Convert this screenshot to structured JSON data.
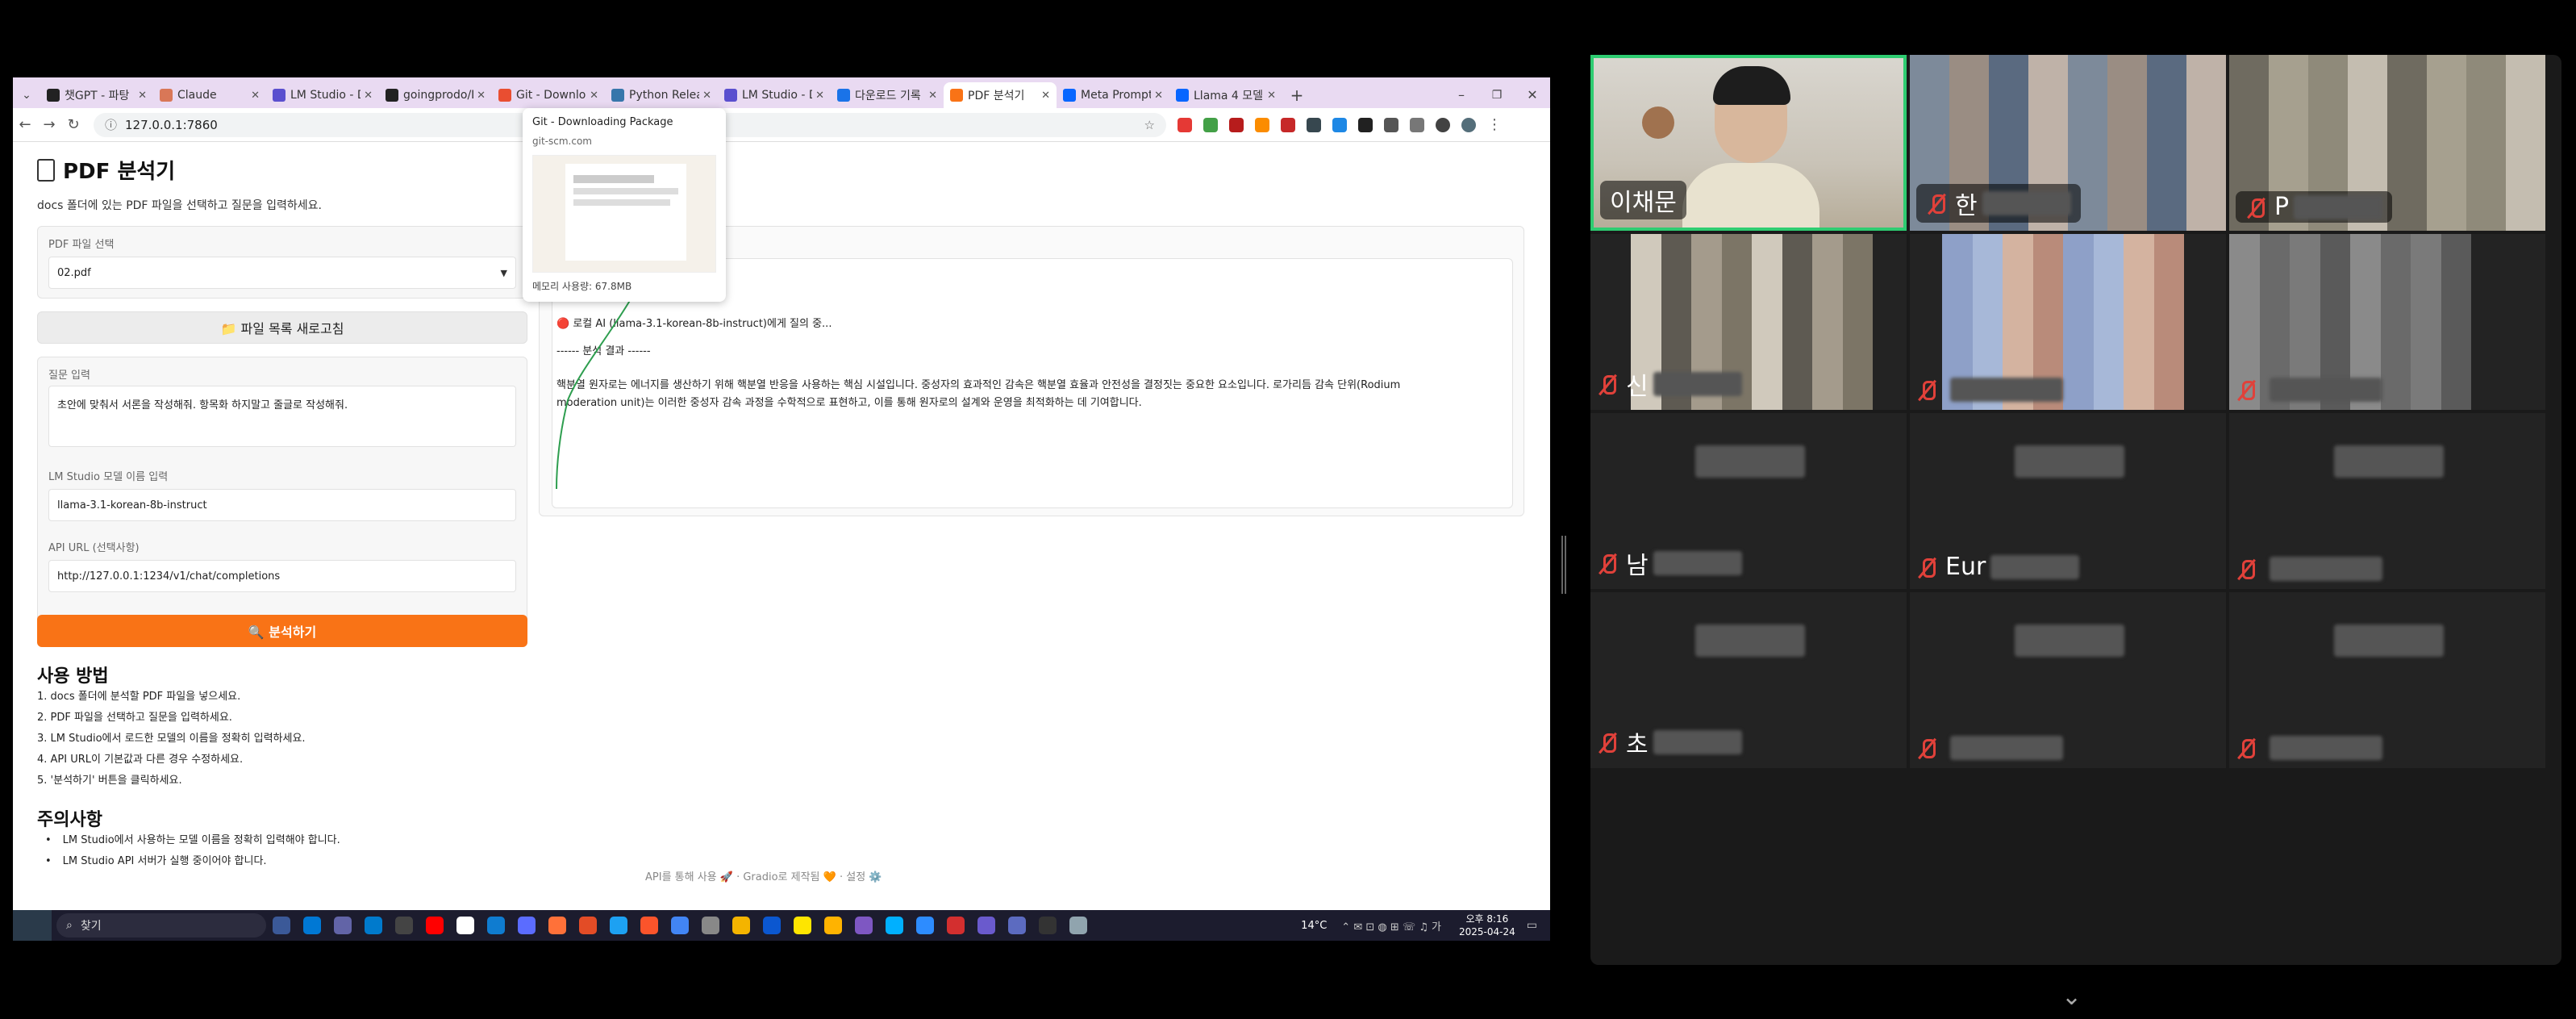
{
  "browser": {
    "tabs": [
      {
        "label": "챗GPT - 파탕",
        "color": "#222"
      },
      {
        "label": "Claude",
        "color": "#d97757"
      },
      {
        "label": "LM Studio - D",
        "color": "#5a4fcf"
      },
      {
        "label": "goingprodo/L",
        "color": "#222"
      },
      {
        "label": "Git - Downloa",
        "color": "#e94e31"
      },
      {
        "label": "Python Releas",
        "color": "#3776ab"
      },
      {
        "label": "LM Studio - D",
        "color": "#5a4fcf"
      },
      {
        "label": "다운로드 기록",
        "color": "#1a73e8"
      },
      {
        "label": "PDF 분석기",
        "color": "#f97316",
        "active": true
      },
      {
        "label": "Meta Promptir",
        "color": "#0866ff"
      },
      {
        "label": "Llama 4 모델",
        "color": "#0866ff"
      }
    ],
    "url": "127.0.0.1:7860",
    "tab_preview": {
      "title": "Git - Downloading Package",
      "domain": "git-scm.com",
      "memory": "메모리 사용량: 67.8MB"
    }
  },
  "app": {
    "title": "PDF 분석기",
    "subtitle": "docs 폴더에 있는 PDF 파일을 선택하고 질문을 입력하세요.",
    "pdf_select_label": "PDF 파일 선택",
    "pdf_select_value": "02.pdf",
    "refresh_button": "📁 파일 목록 새로고침",
    "question_label": "질문 입력",
    "question_value": "초안에 맞춰서 서론을 작성해줘. 항목화 하지말고 줄글로 작성해줘.",
    "model_label": "LM Studio 모델 이름 입력",
    "model_value": "llama-3.1-korean-8b-instruct",
    "api_label": "API URL (선택사항)",
    "api_value": "http://127.0.0.1:1234/v1/chat/completions",
    "analyze_button": "🔍 분석하기",
    "usage_title": "사용 방법",
    "usage_steps": [
      "1. docs 폴더에 분석할 PDF 파일을 넣으세요.",
      "2. PDF 파일을 선택하고 질문을 입력하세요.",
      "3. LM Studio에서 로드한 모델의 이름을 정확히 입력하세요.",
      "4. API URL이 기본값과 다른 경우 수정하세요.",
      "5. '분석하기' 버튼을 클릭하세요."
    ],
    "notes_title": "주의사항",
    "notes": [
      "LM Studio에서 사용하는 모델 이름을 정확히 입력해야 합니다.",
      "LM Studio API 서버가 실행 중이어야 합니다."
    ],
    "output": {
      "status": "🔴 로컬 AI (llama-3.1-korean-8b-instruct)에게 질의 중...",
      "divider": "------ 분석 결과 ------",
      "result_line1": "핵분열 원자로는 에너지를 생산하기 위해 핵분열 반응을 사용하는 핵심 시설입니다. 중성자의 효과적인 감속은 핵분열 효율과 안전성을 결정짓는 중요한 요소입니다. 로가리듬 감속 단위(Rodium",
      "result_line2": "moderation unit)는 이러한 중성자 감속 과정을 수학적으로 표현하고, 이를 통해 원자로의 설계와 운영을 최적화하는 데 기여합니다."
    },
    "footer": "API를 통해 사용  🚀  ·  Gradio로 제작됨  🧡  ·  설정  ⚙️"
  },
  "taskbar": {
    "search_placeholder": "찾기",
    "weather": "14°C",
    "time": "오후 8:16",
    "date": "2025-04-24"
  },
  "gallery": {
    "participants": [
      {
        "name": "이채문",
        "muted": false,
        "active": true
      },
      {
        "name": "한",
        "muted": true
      },
      {
        "name": "P",
        "muted": true
      },
      {
        "name": "신",
        "muted": true
      },
      {
        "name": "",
        "muted": true
      },
      {
        "name": "",
        "muted": true
      },
      {
        "name": "남",
        "muted": true
      },
      {
        "name": "Eur",
        "muted": true
      },
      {
        "name": "",
        "muted": true
      },
      {
        "name": "초",
        "muted": true
      },
      {
        "name": "",
        "muted": true
      },
      {
        "name": "",
        "muted": true
      }
    ]
  },
  "colors": {
    "accent": "#f97316",
    "zoom_active": "#2ecc71",
    "mute": "#e0413a"
  }
}
